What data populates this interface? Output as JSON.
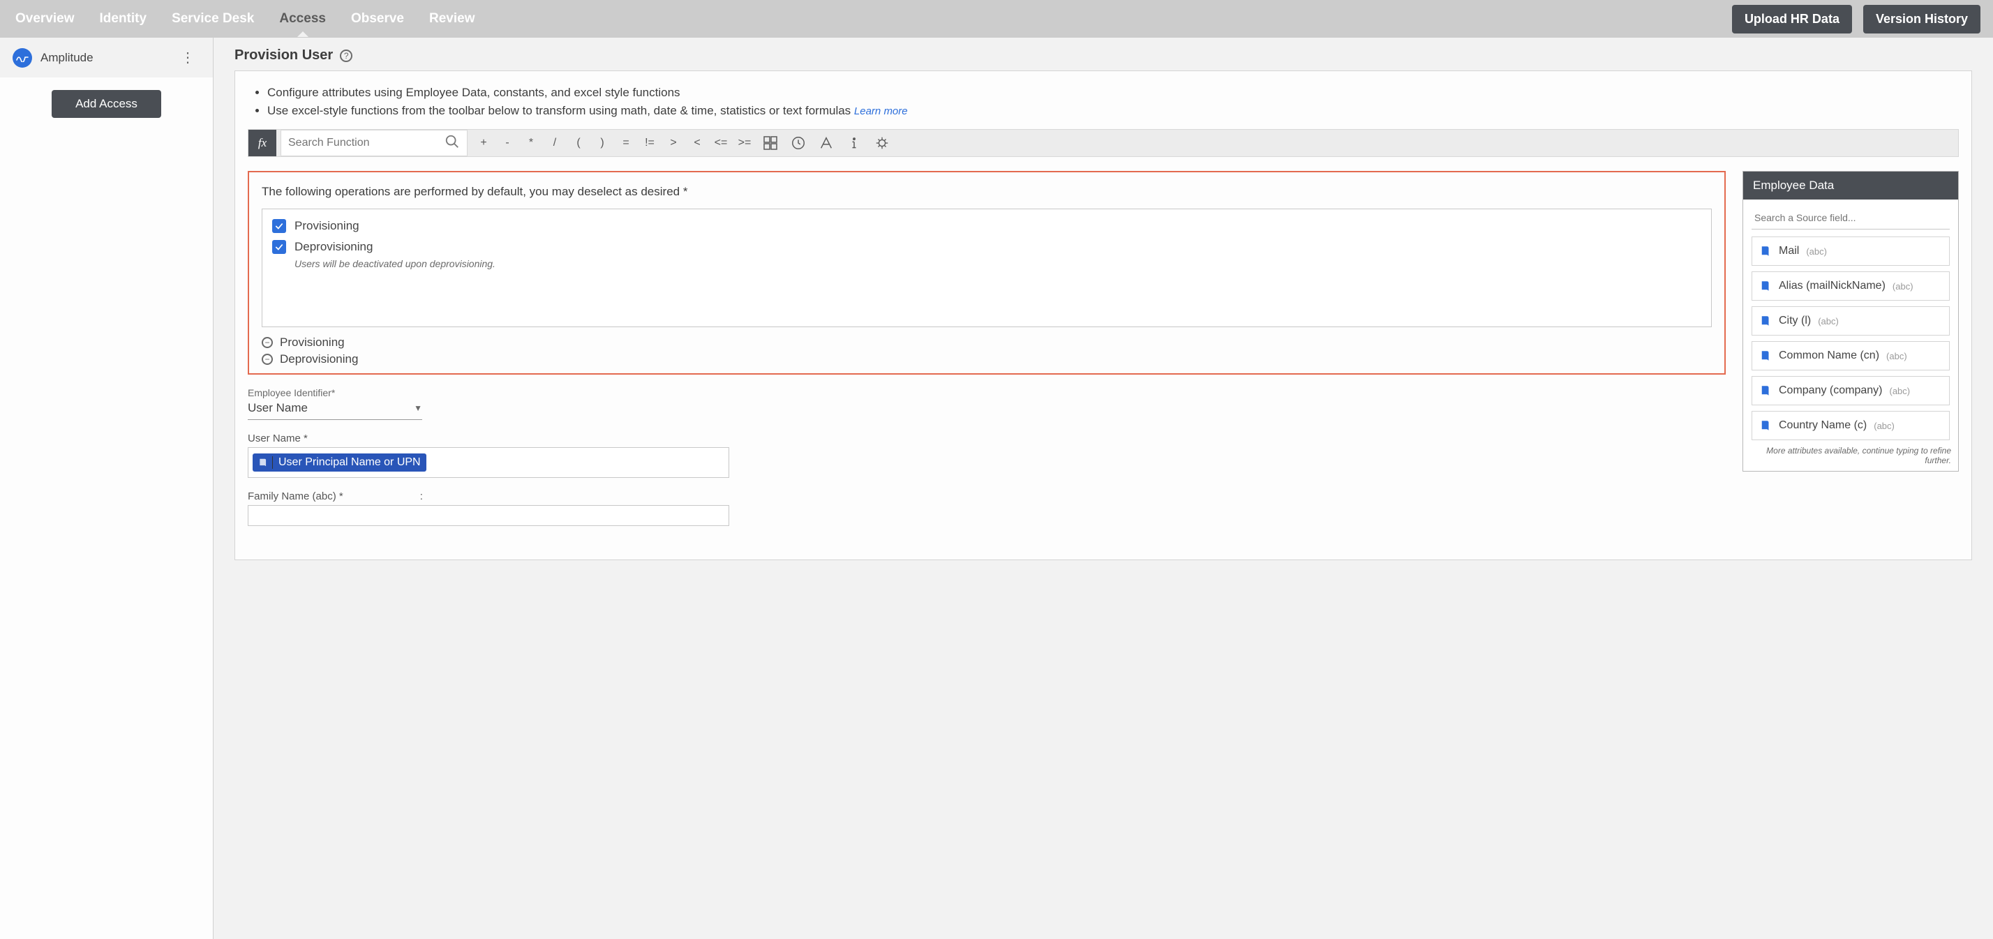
{
  "nav": {
    "tabs": [
      "Overview",
      "Identity",
      "Service Desk",
      "Access",
      "Observe",
      "Review"
    ],
    "active_index": 3,
    "upload_btn": "Upload HR Data",
    "version_btn": "Version History"
  },
  "sidebar": {
    "app_name": "Amplitude",
    "add_btn": "Add Access"
  },
  "page": {
    "title": "Provision User",
    "intro": [
      "Configure attributes using Employee Data, constants, and excel style functions",
      "Use excel-style functions from the toolbar below to transform using math, date & time, statistics or text formulas"
    ],
    "learn_more": "Learn more",
    "search_placeholder": "Search Function",
    "operators": [
      "+",
      "-",
      "*",
      "/",
      "(",
      ")",
      "=",
      "!=",
      ">",
      "<",
      "<=",
      ">="
    ]
  },
  "ops": {
    "heading": "The following operations are performed by default, you may deselect as desired *",
    "items": [
      {
        "label": "Provisioning",
        "checked": true,
        "note": null
      },
      {
        "label": "Deprovisioning",
        "checked": true,
        "note": "Users will be deactivated upon deprovisioning."
      }
    ],
    "collapse": [
      "Provisioning",
      "Deprovisioning"
    ]
  },
  "fields": {
    "identifier_label": "Employee Identifier*",
    "identifier_value": "User Name",
    "username_label": "User Name *",
    "username_tag": "User Principal Name or UPN",
    "family_label": "Family Name (abc) *",
    "family_colon": ":"
  },
  "emp_panel": {
    "title": "Employee Data",
    "search_placeholder": "Search a Source field...",
    "fields": [
      {
        "name": "Mail",
        "type": "(abc)"
      },
      {
        "name": "Alias (mailNickName)",
        "type": "(abc)"
      },
      {
        "name": "City (l)",
        "type": "(abc)"
      },
      {
        "name": "Common Name (cn)",
        "type": "(abc)"
      },
      {
        "name": "Company (company)",
        "type": "(abc)"
      },
      {
        "name": "Country Name (c)",
        "type": "(abc)"
      }
    ],
    "more_note": "More attributes available, continue typing to refine further."
  }
}
